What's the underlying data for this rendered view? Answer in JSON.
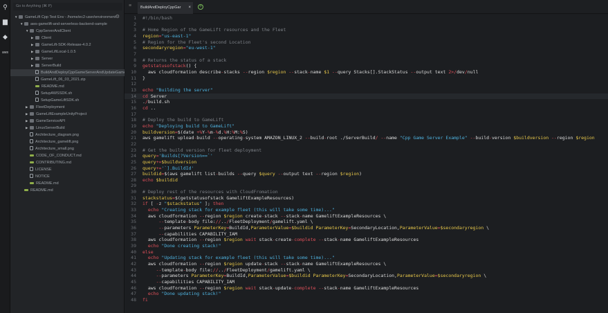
{
  "search": {
    "placeholder": "Go to Anything (⌘ P)"
  },
  "tree": [
    {
      "d": 0,
      "t": "folder-open",
      "label": "GameLift Cpp Test Env - /home/ec2-user/environment"
    },
    {
      "d": 1,
      "t": "folder-open",
      "label": "aws-gamelift-and-serverless-backend-sample"
    },
    {
      "d": 2,
      "t": "folder-open",
      "label": "CppServerAndClient"
    },
    {
      "d": 3,
      "t": "folder",
      "label": "Client"
    },
    {
      "d": 3,
      "t": "folder",
      "label": "GameLift-SDK-Release-4.0.2"
    },
    {
      "d": 3,
      "t": "folder",
      "label": "GameLiftLocal-1.0.5"
    },
    {
      "d": 3,
      "t": "folder",
      "label": "Server"
    },
    {
      "d": 3,
      "t": "folder",
      "label": "ServerBuild"
    },
    {
      "d": 3,
      "t": "file",
      "label": "BuildAndDeployCppGameServerAndUpdateGameLiftRe",
      "sel": true
    },
    {
      "d": 3,
      "t": "file",
      "label": "GameLift_06_03_2021.zip"
    },
    {
      "d": 3,
      "t": "md",
      "label": "README.md"
    },
    {
      "d": 3,
      "t": "file",
      "label": "SetupAWSSDK.sh"
    },
    {
      "d": 3,
      "t": "file",
      "label": "SetupGameLiftSDK.sh"
    },
    {
      "d": 2,
      "t": "folder",
      "label": "FleetDeployment"
    },
    {
      "d": 2,
      "t": "folder",
      "label": "GameLiftExampleUnityProject"
    },
    {
      "d": 2,
      "t": "folder",
      "label": "GameServiceAPI"
    },
    {
      "d": 2,
      "t": "folder",
      "label": "LinuxServerBuild"
    },
    {
      "d": 2,
      "t": "file",
      "label": "Architecture_diagram.png"
    },
    {
      "d": 2,
      "t": "file",
      "label": "Architecture_gamelift.png"
    },
    {
      "d": 2,
      "t": "file",
      "label": "Architecture_small.png"
    },
    {
      "d": 2,
      "t": "md",
      "label": "CODE_OF_CONDUCT.md"
    },
    {
      "d": 2,
      "t": "md",
      "label": "CONTRIBUTING.md"
    },
    {
      "d": 2,
      "t": "file",
      "label": "LICENSE"
    },
    {
      "d": 2,
      "t": "file",
      "label": "NOTICE"
    },
    {
      "d": 2,
      "t": "md",
      "label": "README.md"
    },
    {
      "d": 1,
      "t": "md",
      "label": "README.md"
    }
  ],
  "tab": {
    "label": "BuildAndDeployCppGar",
    "close": "×",
    "add": "+"
  },
  "editor": {
    "current_line": 14,
    "lines": [
      [
        [
          "c",
          "#!/bin/bash"
        ]
      ],
      [],
      [
        [
          "c",
          "# Home Region of the GameLift resources and the Fleet"
        ]
      ],
      [
        [
          "v",
          "region"
        ],
        [
          "o",
          "="
        ],
        [
          "s",
          "\"us-east-1\""
        ]
      ],
      [
        [
          "c",
          "# Region for the Fleet's second Location"
        ]
      ],
      [
        [
          "v",
          "secondaryregion"
        ],
        [
          "o",
          "="
        ],
        [
          "s",
          "\"eu-west-1\""
        ]
      ],
      [],
      [
        [
          "c",
          "# Returns the status of a stack"
        ]
      ],
      [
        [
          "k",
          "getstatusofstack"
        ],
        [
          "t",
          "() {"
        ]
      ],
      [
        [
          "t",
          "  aws cloudformation describe"
        ],
        [
          "o",
          "-"
        ],
        [
          "t",
          "stacks "
        ],
        [
          "o",
          "--"
        ],
        [
          "t",
          "region "
        ],
        [
          "v",
          "$region"
        ],
        [
          "t",
          " "
        ],
        [
          "o",
          "--"
        ],
        [
          "t",
          "stack"
        ],
        [
          "o",
          "-"
        ],
        [
          "t",
          "name "
        ],
        [
          "v",
          "$1"
        ],
        [
          "t",
          " "
        ],
        [
          "o",
          "--"
        ],
        [
          "t",
          "query Stacks[].StackStatus "
        ],
        [
          "o",
          "--"
        ],
        [
          "t",
          "output text "
        ],
        [
          "o",
          "2>/"
        ],
        [
          "t",
          "dev"
        ],
        [
          "o",
          "/"
        ],
        [
          "t",
          "null"
        ]
      ],
      [
        [
          "t",
          "}"
        ]
      ],
      [],
      [
        [
          "k",
          "echo"
        ],
        [
          "t",
          " "
        ],
        [
          "s",
          "\"Building the server\""
        ]
      ],
      [
        [
          "k",
          "cd"
        ],
        [
          "t",
          " Server"
        ]
      ],
      [
        [
          "t",
          "."
        ],
        [
          "o",
          "/"
        ],
        [
          "t",
          "build.sh"
        ]
      ],
      [
        [
          "k",
          "cd"
        ],
        [
          "t",
          " .."
        ]
      ],
      [],
      [
        [
          "c",
          "# Deploy the build to GameLift"
        ]
      ],
      [
        [
          "k",
          "echo"
        ],
        [
          "t",
          " "
        ],
        [
          "s",
          "\"Deploying build to GameLift\""
        ]
      ],
      [
        [
          "v",
          "buildversion"
        ],
        [
          "o",
          "="
        ],
        [
          "t",
          "$(date "
        ],
        [
          "o",
          "+%"
        ],
        [
          "t",
          "Y"
        ],
        [
          "o",
          "-%"
        ],
        [
          "t",
          "m"
        ],
        [
          "o",
          "-%"
        ],
        [
          "t",
          "d."
        ],
        [
          "o",
          "%"
        ],
        [
          "t",
          "H:"
        ],
        [
          "o",
          "%"
        ],
        [
          "t",
          "M:"
        ],
        [
          "o",
          "%"
        ],
        [
          "t",
          "S)"
        ]
      ],
      [
        [
          "t",
          "aws gamelift upload"
        ],
        [
          "o",
          "-"
        ],
        [
          "t",
          "build "
        ],
        [
          "o",
          "--"
        ],
        [
          "t",
          "operating"
        ],
        [
          "o",
          "-"
        ],
        [
          "t",
          "system AMAZON_LINUX_2 "
        ],
        [
          "o",
          "--"
        ],
        [
          "t",
          "build"
        ],
        [
          "o",
          "-"
        ],
        [
          "t",
          "root ./ServerBuild"
        ],
        [
          "o",
          "/"
        ],
        [
          "t",
          " "
        ],
        [
          "o",
          "--"
        ],
        [
          "t",
          "name "
        ],
        [
          "s",
          "\"Cpp Game Server Example\""
        ],
        [
          "t",
          " "
        ],
        [
          "o",
          "--"
        ],
        [
          "t",
          "build"
        ],
        [
          "o",
          "-"
        ],
        [
          "t",
          "version "
        ],
        [
          "v",
          "$buildversion"
        ],
        [
          "t",
          " "
        ],
        [
          "o",
          "--"
        ],
        [
          "t",
          "region "
        ],
        [
          "v",
          "$region"
        ]
      ],
      [],
      [
        [
          "c",
          "# Get the build version for fleet deployment"
        ]
      ],
      [
        [
          "v",
          "query"
        ],
        [
          "o",
          "="
        ],
        [
          "s",
          "'Builds[?Version==`'"
        ]
      ],
      [
        [
          "v",
          "query"
        ],
        [
          "o",
          "+="
        ],
        [
          "v",
          "$buildversion"
        ]
      ],
      [
        [
          "v",
          "query"
        ],
        [
          "o",
          "+="
        ],
        [
          "s",
          "'`].BuildId'"
        ]
      ],
      [
        [
          "v",
          "buildid"
        ],
        [
          "o",
          "="
        ],
        [
          "t",
          "$(aws gamelift list"
        ],
        [
          "o",
          "-"
        ],
        [
          "t",
          "builds "
        ],
        [
          "o",
          "--"
        ],
        [
          "t",
          "query "
        ],
        [
          "v",
          "$query"
        ],
        [
          "t",
          " "
        ],
        [
          "o",
          "--"
        ],
        [
          "t",
          "output text "
        ],
        [
          "o",
          "--"
        ],
        [
          "t",
          "region "
        ],
        [
          "v",
          "$region"
        ],
        [
          "t",
          ")"
        ]
      ],
      [
        [
          "k",
          "echo"
        ],
        [
          "t",
          " "
        ],
        [
          "v",
          "$buildid"
        ]
      ],
      [],
      [
        [
          "c",
          "# Deploy rest of the resources with CloudFromation"
        ]
      ],
      [
        [
          "v",
          "stackstatus"
        ],
        [
          "o",
          "="
        ],
        [
          "t",
          "$(getstatusofstack GameliftExampleResources)"
        ]
      ],
      [
        [
          "k",
          "if"
        ],
        [
          "t",
          " [ "
        ],
        [
          "o",
          "-"
        ],
        [
          "t",
          "z "
        ],
        [
          "s",
          "\""
        ],
        [
          "v",
          "$stackstatus"
        ],
        [
          "s",
          "\""
        ],
        [
          "t",
          " ]; "
        ],
        [
          "k",
          "then"
        ]
      ],
      [
        [
          "t",
          "  "
        ],
        [
          "k",
          "echo"
        ],
        [
          "t",
          " "
        ],
        [
          "s",
          "\"Creating stack for example fleet (this will take some time)...\""
        ]
      ],
      [
        [
          "t",
          "  aws cloudformation "
        ],
        [
          "o",
          "--"
        ],
        [
          "t",
          "region "
        ],
        [
          "v",
          "$region"
        ],
        [
          "t",
          " create"
        ],
        [
          "o",
          "-"
        ],
        [
          "t",
          "stack "
        ],
        [
          "o",
          "--"
        ],
        [
          "t",
          "stack"
        ],
        [
          "o",
          "-"
        ],
        [
          "t",
          "name GameliftExampleResources \\"
        ]
      ],
      [
        [
          "t",
          "      "
        ],
        [
          "o",
          "--"
        ],
        [
          "t",
          "template"
        ],
        [
          "o",
          "-"
        ],
        [
          "t",
          "body file:"
        ],
        [
          "o",
          "//"
        ],
        [
          "t",
          ".."
        ],
        [
          "o",
          "/"
        ],
        [
          "t",
          "FleetDeployment"
        ],
        [
          "o",
          "/"
        ],
        [
          "t",
          "gamelift.yaml \\"
        ]
      ],
      [
        [
          "t",
          "      "
        ],
        [
          "o",
          "--"
        ],
        [
          "t",
          "parameters "
        ],
        [
          "v",
          "ParameterKey"
        ],
        [
          "o",
          "="
        ],
        [
          "t",
          "BuildId,"
        ],
        [
          "v",
          "ParameterValue"
        ],
        [
          "o",
          "="
        ],
        [
          "v",
          "$buildid"
        ],
        [
          "t",
          " "
        ],
        [
          "v",
          "ParameterKey"
        ],
        [
          "o",
          "="
        ],
        [
          "t",
          "SecondaryLocation,"
        ],
        [
          "v",
          "ParameterValue"
        ],
        [
          "o",
          "="
        ],
        [
          "v",
          "$secondaryregion"
        ],
        [
          "t",
          " \\"
        ]
      ],
      [
        [
          "t",
          "      "
        ],
        [
          "o",
          "--"
        ],
        [
          "t",
          "capabilities CAPABILITY_IAM"
        ]
      ],
      [
        [
          "t",
          "  aws cloudformation "
        ],
        [
          "o",
          "--"
        ],
        [
          "t",
          "region "
        ],
        [
          "v",
          "$region"
        ],
        [
          "t",
          " "
        ],
        [
          "k",
          "wait"
        ],
        [
          "t",
          " stack"
        ],
        [
          "o",
          "-"
        ],
        [
          "t",
          "create"
        ],
        [
          "o",
          "-"
        ],
        [
          "k",
          "complete"
        ],
        [
          "t",
          " "
        ],
        [
          "o",
          "--"
        ],
        [
          "t",
          "stack"
        ],
        [
          "o",
          "-"
        ],
        [
          "t",
          "name GameliftExampleResources"
        ]
      ],
      [
        [
          "t",
          "  "
        ],
        [
          "k",
          "echo"
        ],
        [
          "t",
          " "
        ],
        [
          "s",
          "\"Done creating stack!\""
        ]
      ],
      [
        [
          "k",
          "else"
        ]
      ],
      [
        [
          "t",
          "  "
        ],
        [
          "k",
          "echo"
        ],
        [
          "t",
          " "
        ],
        [
          "s",
          "\"Updating stack for example fleet (this will take some time)...\""
        ]
      ],
      [
        [
          "t",
          "  aws cloudformation "
        ],
        [
          "o",
          "--"
        ],
        [
          "t",
          "region "
        ],
        [
          "v",
          "$region"
        ],
        [
          "t",
          " update"
        ],
        [
          "o",
          "-"
        ],
        [
          "t",
          "stack "
        ],
        [
          "o",
          "--"
        ],
        [
          "t",
          "stack"
        ],
        [
          "o",
          "-"
        ],
        [
          "t",
          "name GameliftExampleResources \\"
        ]
      ],
      [
        [
          "t",
          "     "
        ],
        [
          "o",
          "--"
        ],
        [
          "t",
          "template"
        ],
        [
          "o",
          "-"
        ],
        [
          "t",
          "body file:"
        ],
        [
          "o",
          "//"
        ],
        [
          "t",
          ".."
        ],
        [
          "o",
          "/"
        ],
        [
          "t",
          "FleetDeployment"
        ],
        [
          "o",
          "/"
        ],
        [
          "t",
          "gamelift.yaml \\"
        ]
      ],
      [
        [
          "t",
          "     "
        ],
        [
          "o",
          "--"
        ],
        [
          "t",
          "parameters "
        ],
        [
          "v",
          "ParameterKey"
        ],
        [
          "o",
          "="
        ],
        [
          "t",
          "BuildId,"
        ],
        [
          "v",
          "ParameterValue"
        ],
        [
          "o",
          "="
        ],
        [
          "v",
          "$buildid"
        ],
        [
          "t",
          " "
        ],
        [
          "v",
          "ParameterKey"
        ],
        [
          "o",
          "="
        ],
        [
          "t",
          "SecondaryLocation,"
        ],
        [
          "v",
          "ParameterValue"
        ],
        [
          "o",
          "="
        ],
        [
          "v",
          "$secondaryregion"
        ],
        [
          "t",
          " \\"
        ]
      ],
      [
        [
          "t",
          "     "
        ],
        [
          "o",
          "--"
        ],
        [
          "t",
          "capabilities CAPABILITY_IAM"
        ]
      ],
      [
        [
          "t",
          "  aws cloudformation "
        ],
        [
          "o",
          "--"
        ],
        [
          "t",
          "region "
        ],
        [
          "v",
          "$region"
        ],
        [
          "t",
          " "
        ],
        [
          "k",
          "wait"
        ],
        [
          "t",
          " stack"
        ],
        [
          "o",
          "-"
        ],
        [
          "t",
          "update"
        ],
        [
          "o",
          "-"
        ],
        [
          "k",
          "complete"
        ],
        [
          "t",
          " "
        ],
        [
          "o",
          "--"
        ],
        [
          "t",
          "stack"
        ],
        [
          "o",
          "-"
        ],
        [
          "t",
          "name GameliftExampleResources"
        ]
      ],
      [
        [
          "t",
          "  "
        ],
        [
          "k",
          "echo"
        ],
        [
          "t",
          " "
        ],
        [
          "s",
          "\"Done updating stack!\""
        ]
      ],
      [
        [
          "k",
          "fi"
        ]
      ]
    ]
  }
}
